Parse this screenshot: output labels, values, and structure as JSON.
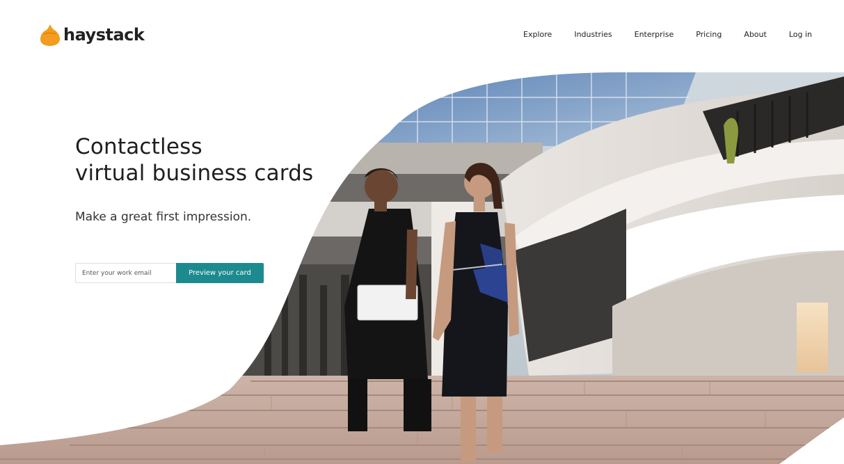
{
  "brand": {
    "name": "haystack",
    "logo_icon": "haystack-logo-icon",
    "accent_color": "#f39c1f"
  },
  "nav": {
    "items": [
      {
        "label": "Explore"
      },
      {
        "label": "Industries"
      },
      {
        "label": "Enterprise"
      },
      {
        "label": "Pricing"
      },
      {
        "label": "About"
      },
      {
        "label": "Log in"
      }
    ]
  },
  "hero": {
    "headline_line1": "Contactless",
    "headline_line2": "virtual business cards",
    "subheadline": "Make a great first impression.",
    "email_placeholder": "Enter your work email",
    "cta_label": "Preview your card",
    "cta_color": "#1d8a8f",
    "image_description_alt": "Two women walking down outdoor stone steps in front of a modern curved building"
  }
}
